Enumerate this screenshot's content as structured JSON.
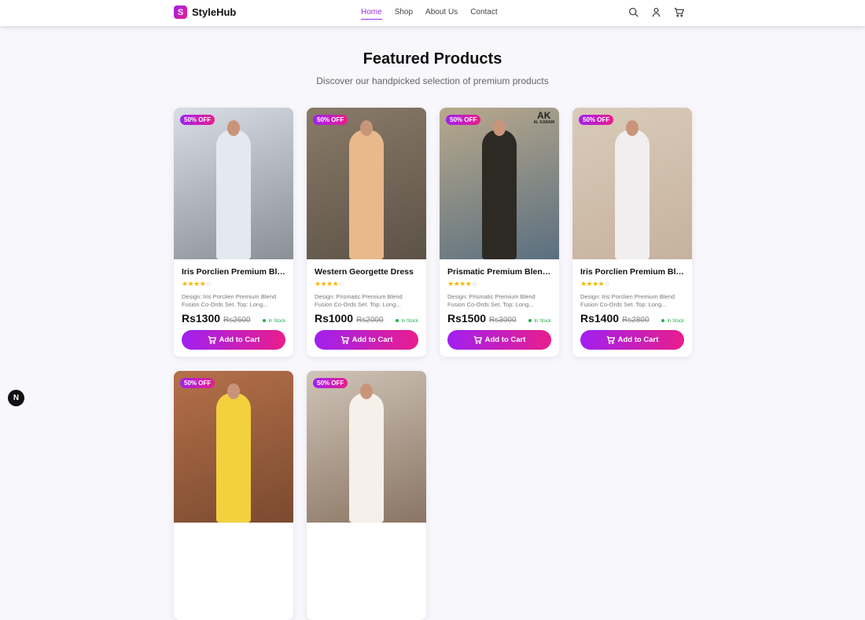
{
  "header": {
    "logo_letter": "S",
    "brand": "StyleHub",
    "nav": [
      "Home",
      "Shop",
      "About Us",
      "Contact"
    ],
    "active": "Home"
  },
  "section": {
    "title": "Featured Products",
    "subtitle": "Discover our handpicked selection of premium products"
  },
  "products": [
    {
      "badge": "50% OFF",
      "title": "Iris Porclien Premium Ble...",
      "rating": 4,
      "desc1": "Design: Iris Porclien Premium Blend",
      "desc2": "Fusion Co-Ords Set. Top: Long...",
      "price": "Rs1300",
      "old": "Rs2600",
      "stock": "In Stock",
      "cta": "Add to Cart"
    },
    {
      "badge": "50% OFF",
      "title": "Western Georgette Dress",
      "rating": 4,
      "desc1": "Design: Prismatic Premium Blend",
      "desc2": "Fusion Co-Ords Set. Top: Long...",
      "price": "Rs1000",
      "old": "Rs2000",
      "stock": "In Stock",
      "cta": "Add to Cart"
    },
    {
      "badge": "50% OFF",
      "title": "Prismatic Premium Blend...",
      "rating": 4,
      "desc1": "Design: Prismatic Premium Blend",
      "desc2": "Fusion Co-Ords Set. Top: Long...",
      "price": "Rs1500",
      "old": "Rs3000",
      "stock": "In Stock",
      "cta": "Add to Cart",
      "image_brand": "AK",
      "image_brand_sub": "AL KARAM"
    },
    {
      "badge": "50% OFF",
      "title": "Iris Porclien Premium Ble...",
      "rating": 4,
      "desc1": "Design: Iris Porclien Premium Blend",
      "desc2": "Fusion Co-Ords Set. Top: Long...",
      "price": "Rs1400",
      "old": "Rs2800",
      "stock": "In Stock",
      "cta": "Add to Cart"
    },
    {
      "badge": "50% OFF"
    },
    {
      "badge": "50% OFF"
    }
  ],
  "dev_badge": "N"
}
